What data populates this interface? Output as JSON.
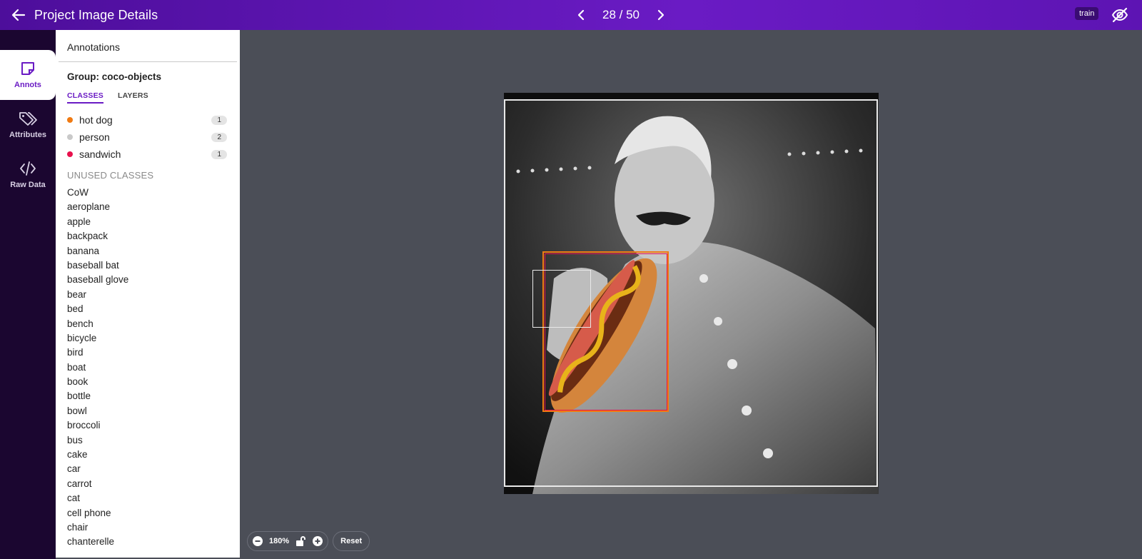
{
  "header": {
    "title": "Project Image Details",
    "pager": "28 / 50",
    "split_badge": "train",
    "bg_color": "#6a1bc4"
  },
  "rail": {
    "items": [
      {
        "label": "Annots",
        "icon": "sticky-note-icon",
        "active": true
      },
      {
        "label": "Attributes",
        "icon": "tags-icon",
        "active": false
      },
      {
        "label": "Raw Data",
        "icon": "code-icon",
        "active": false
      }
    ]
  },
  "panel": {
    "heading": "Annotations",
    "group_title": "Group: coco-objects",
    "tabs": [
      "CLASSES",
      "LAYERS"
    ],
    "classes": [
      {
        "name": "hot dog",
        "count": "1",
        "color": "#f07a12"
      },
      {
        "name": "person",
        "count": "2",
        "color": "#c9c9c9"
      },
      {
        "name": "sandwich",
        "count": "1",
        "color": "#e8114d"
      }
    ],
    "unused_heading": "UNUSED CLASSES",
    "unused_classes": [
      "CoW",
      "aeroplane",
      "apple",
      "backpack",
      "banana",
      "baseball bat",
      "baseball glove",
      "bear",
      "bed",
      "bench",
      "bicycle",
      "bird",
      "boat",
      "book",
      "bottle",
      "bowl",
      "broccoli",
      "bus",
      "cake",
      "car",
      "carrot",
      "cat",
      "cell phone",
      "chair",
      "chanterelle"
    ]
  },
  "zoom": {
    "level": "180%",
    "reset_label": "Reset"
  }
}
